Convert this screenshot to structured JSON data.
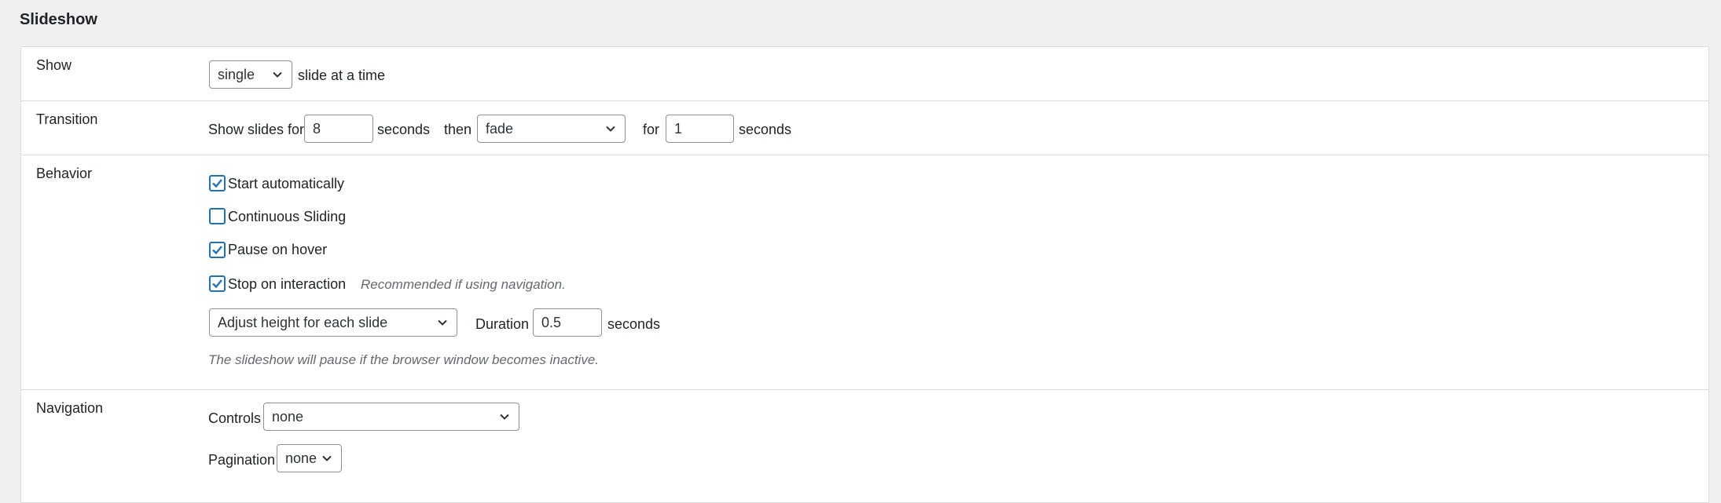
{
  "section": {
    "title": "Slideshow"
  },
  "show": {
    "label": "Show",
    "select_value": "single",
    "suffix": "slide at a time"
  },
  "transition": {
    "label": "Transition",
    "show_for_label": "Show slides for",
    "show_for_value": "8",
    "seconds_label": "seconds",
    "then_label": "then",
    "effect_value": "fade",
    "for_label": "for",
    "for_value": "1",
    "seconds_label_2": "seconds"
  },
  "behavior": {
    "label": "Behavior",
    "options": [
      {
        "label": "Start automatically",
        "checked": true
      },
      {
        "label": "Continuous Sliding",
        "checked": false
      },
      {
        "label": "Pause on hover",
        "checked": true
      },
      {
        "label": "Stop on interaction",
        "checked": true
      }
    ],
    "stop_hint": "Recommended if using navigation.",
    "height_select_value": "Adjust height for each slide",
    "duration_label": "Duration",
    "duration_value": "0.5",
    "duration_unit": "seconds",
    "note": "The slideshow will pause if the browser window becomes inactive."
  },
  "navigation": {
    "label": "Navigation",
    "controls_label": "Controls",
    "controls_value": "none",
    "pagination_label": "Pagination",
    "pagination_value": "none"
  },
  "colors": {
    "accent": "#2271b1",
    "border": "#dcdcde",
    "background": "#f0f0f1"
  },
  "icons": {
    "dropdown": "chevron-down-icon",
    "check": "checkmark-icon"
  }
}
